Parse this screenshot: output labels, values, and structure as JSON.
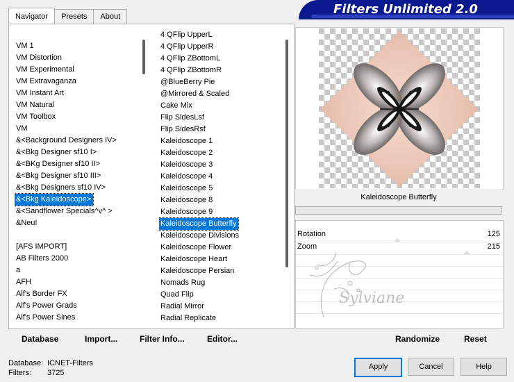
{
  "app": {
    "title": "Filters Unlimited 2.0"
  },
  "tabs": [
    {
      "label": "Navigator",
      "active": true
    },
    {
      "label": "Presets",
      "active": false
    },
    {
      "label": "About",
      "active": false
    }
  ],
  "categories": [
    "VM 1",
    "VM Distortion",
    "VM Experimental",
    "VM Extravaganza",
    "VM Instant Art",
    "VM Natural",
    "VM Toolbox",
    "VM",
    "&<Background Designers IV>",
    "&<Bkg Designer sf10 I>",
    "&<BKg Designer sf10 II>",
    "&<Bkg Designer sf10 III>",
    "&<Bkg Designers sf10 IV>",
    "&<Bkg Kaleidoscope>",
    "&<Sandflower Specials^v^ >",
    "&Neu!",
    "",
    "[AFS IMPORT]",
    "AB Filters 2000",
    "a",
    "AFH",
    "Alf's Border FX",
    "Alf's Power Grads",
    "Alf's Power Sines"
  ],
  "categories_selected": 13,
  "filters": [
    "4 QFlip UpperL",
    "4 QFlip UpperR",
    "4 QFlip ZBottomL",
    "4 QFlip ZBottomR",
    "@BlueBerry Pie",
    "@Mirrored & Scaled",
    "Cake Mix",
    "Flip SidesLsf",
    "Flip SidesRsf",
    "Kaleidoscope 1",
    "Kaleidoscope 2",
    "Kaleidoscope 3",
    "Kaleidoscope 4",
    "Kaleidoscope 5",
    "Kaleidoscope 8",
    "Kaleidoscope 9",
    "Kaleidoscope Butterfly",
    "Kaleidoscope Divisions",
    "Kaleidoscope Flower",
    "Kaleidoscope Heart",
    "Kaleidoscope Persian",
    "Nomads Rug",
    "Quad Flip",
    "Radial Mirror",
    "Radial Replicate"
  ],
  "filters_selected": 16,
  "buttons": {
    "database": "Database",
    "import": "Import...",
    "filter_info": "Filter Info...",
    "editor": "Editor...",
    "randomize": "Randomize",
    "reset": "Reset",
    "apply": "Apply",
    "cancel": "Cancel",
    "help": "Help"
  },
  "preview": {
    "filter_name": "Kaleidoscope Butterfly"
  },
  "params": [
    {
      "name": "Rotation",
      "value": "125"
    },
    {
      "name": "Zoom",
      "value": "215"
    }
  ],
  "info": {
    "database_label": "Database:",
    "database_value": "ICNET-Filters",
    "filters_label": "Filters:",
    "filters_value": "3725"
  },
  "watermark_text": "Sylviane",
  "colors": {
    "selection": "#0078d7",
    "title_bar": "#0a1a8e",
    "preview_tint": "#e8c2b2"
  }
}
